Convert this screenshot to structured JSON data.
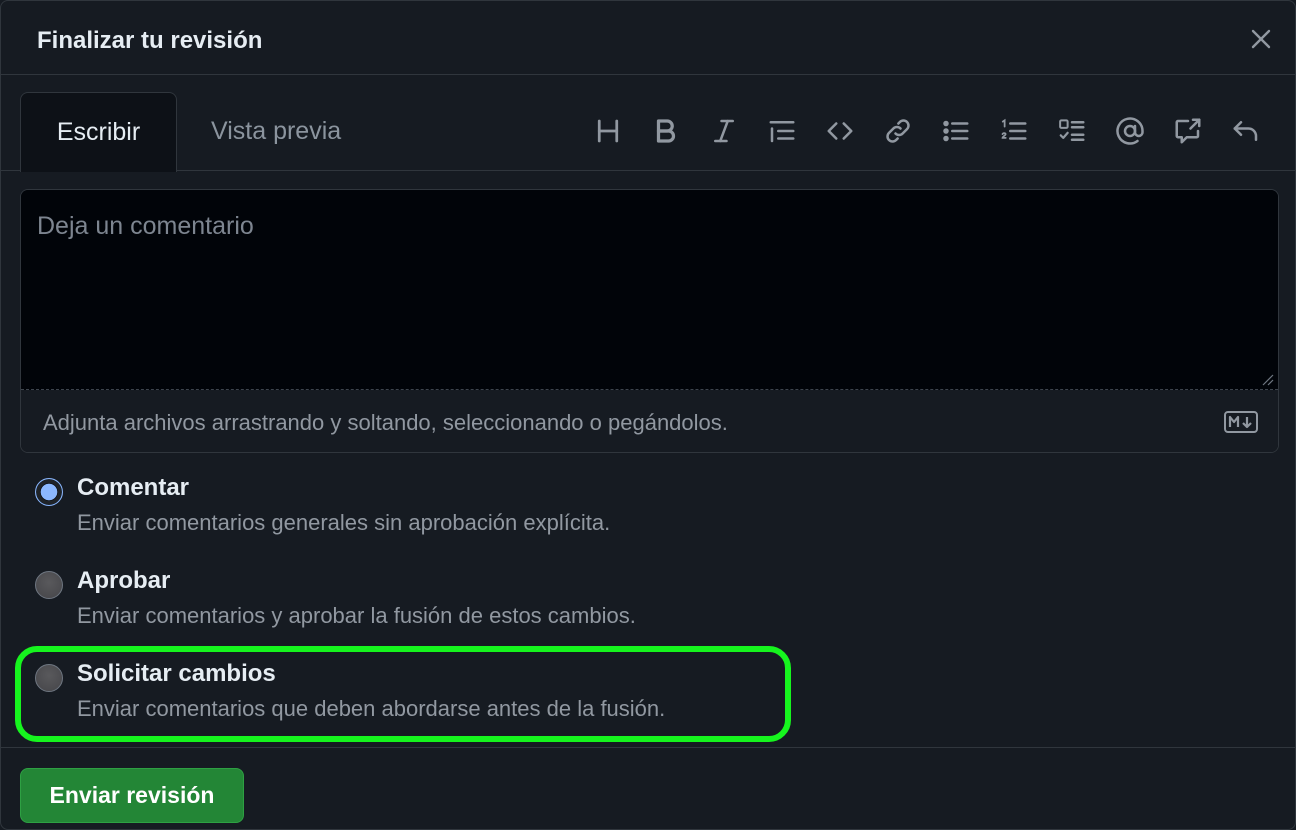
{
  "dialog": {
    "title": "Finalizar tu revisión"
  },
  "tabs": {
    "write_label": "Escribir",
    "preview_label": "Vista previa"
  },
  "toolbar": {
    "tools": [
      "heading-icon",
      "bold-icon",
      "italic-icon",
      "quote-icon",
      "code-icon",
      "link-icon",
      "bulleted-list-icon",
      "numbered-list-icon",
      "task-list-icon",
      "mention-icon",
      "reference-icon",
      "undo-icon"
    ]
  },
  "editor": {
    "placeholder": "Deja un comentario",
    "attach_hint": "Adjunta archivos arrastrando y soltando, seleccionando o pegándolos."
  },
  "options": [
    {
      "title": "Comentar",
      "description": "Enviar comentarios generales sin aprobación explícita.",
      "checked": true
    },
    {
      "title": "Aprobar",
      "description": "Enviar comentarios y aprobar la fusión de estos cambios.",
      "checked": false
    },
    {
      "title": "Solicitar cambios",
      "description": "Enviar comentarios que deben abordarse antes de la fusión.",
      "checked": false
    }
  ],
  "footer": {
    "submit_label": "Enviar revisión"
  },
  "colors": {
    "highlight": "#16f51e",
    "submit": "#238636",
    "background": "#161b22"
  }
}
